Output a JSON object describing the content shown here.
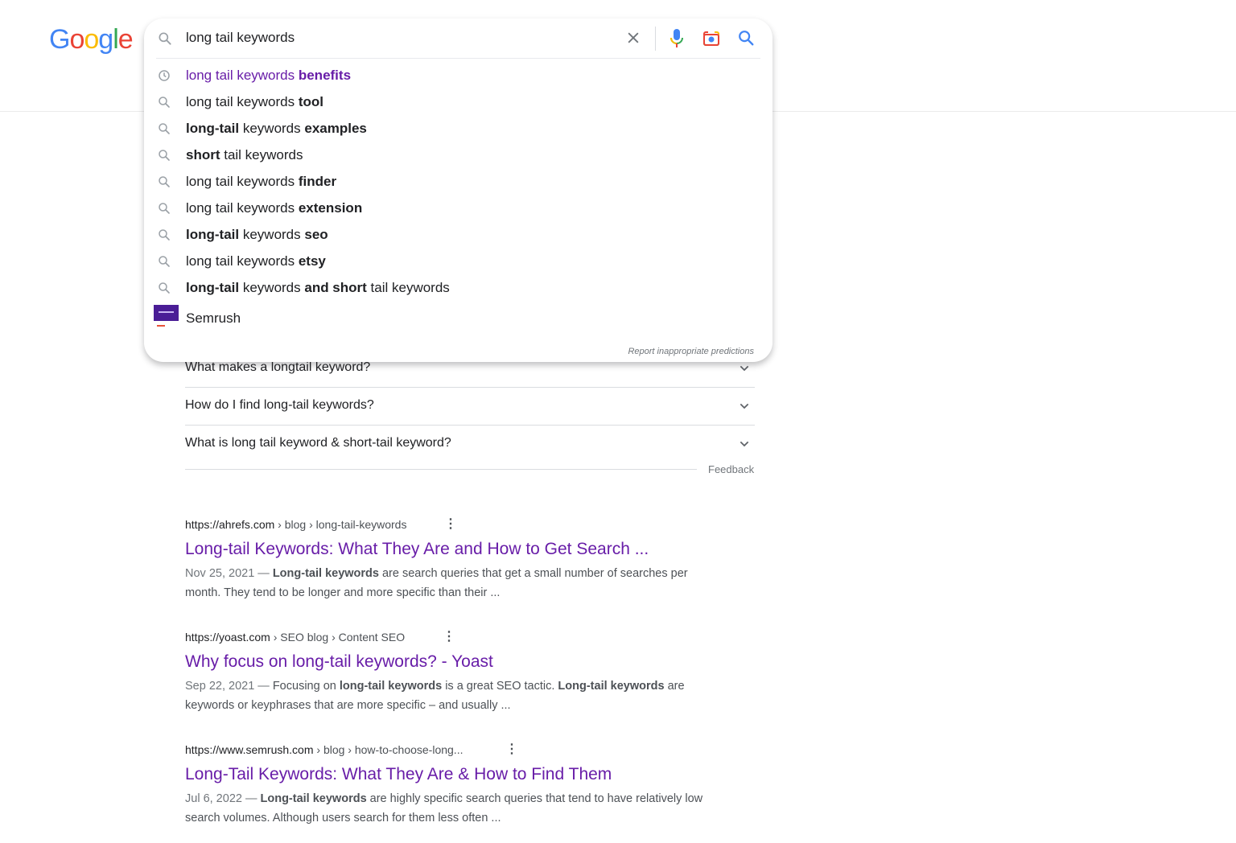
{
  "logo": {
    "letters": [
      "G",
      "o",
      "o",
      "g",
      "l",
      "e"
    ],
    "colors": [
      "#4285f4",
      "#ea4335",
      "#fbbc05",
      "#4285f4",
      "#34a853",
      "#ea4335"
    ]
  },
  "search": {
    "query": "long tail keywords",
    "suggestions": [
      {
        "icon": "history-icon",
        "parts": [
          [
            "long tail keywords ",
            false
          ],
          [
            "benefits",
            true
          ]
        ],
        "visited": true
      },
      {
        "icon": "search-icon",
        "parts": [
          [
            "long tail keywords ",
            false
          ],
          [
            "tool",
            true
          ]
        ]
      },
      {
        "icon": "search-icon",
        "parts": [
          [
            "long-tail",
            true
          ],
          [
            " keywords ",
            false
          ],
          [
            "examples",
            true
          ]
        ]
      },
      {
        "icon": "search-icon",
        "parts": [
          [
            "short",
            true
          ],
          [
            " tail keywords",
            false
          ]
        ]
      },
      {
        "icon": "search-icon",
        "parts": [
          [
            "long tail keywords ",
            false
          ],
          [
            "finder",
            true
          ]
        ]
      },
      {
        "icon": "search-icon",
        "parts": [
          [
            "long tail keywords ",
            false
          ],
          [
            "extension",
            true
          ]
        ]
      },
      {
        "icon": "search-icon",
        "parts": [
          [
            "long-tail",
            true
          ],
          [
            " keywords ",
            false
          ],
          [
            "seo",
            true
          ]
        ]
      },
      {
        "icon": "search-icon",
        "parts": [
          [
            "long tail keywords ",
            false
          ],
          [
            "etsy",
            true
          ]
        ]
      },
      {
        "icon": "search-icon",
        "parts": [
          [
            "long-tail",
            true
          ],
          [
            " keywords ",
            false
          ],
          [
            "and short",
            true
          ],
          [
            " tail keywords",
            false
          ]
        ]
      }
    ],
    "entity_suggestion": "Semrush",
    "report_link": "Report inappropriate predictions"
  },
  "paa": {
    "questions": [
      "What makes a longtail keyword?",
      "How do I find long-tail keywords?",
      "What is long tail keyword & short-tail keyword?"
    ],
    "feedback": "Feedback"
  },
  "results": [
    {
      "domain": "https://ahrefs.com",
      "path": " › blog › long-tail-keywords",
      "title": "Long-tail Keywords: What They Are and How to Get Search ...",
      "date": "Nov 25, 2021 — ",
      "snippet": [
        [
          "Long-tail keywords",
          true
        ],
        [
          " are search queries that get a small number of searches per month. They tend to be longer and more specific than their ...",
          false
        ]
      ]
    },
    {
      "domain": "https://yoast.com",
      "path": " › SEO blog › Content SEO",
      "title": "Why focus on long-tail keywords? - Yoast",
      "date": "Sep 22, 2021 — ",
      "snippet": [
        [
          "Focusing on ",
          false
        ],
        [
          "long-tail keywords",
          true
        ],
        [
          " is a great SEO tactic. ",
          false
        ],
        [
          "Long-tail keywords",
          true
        ],
        [
          " are keywords or keyphrases that are more specific – and usually ...",
          false
        ]
      ]
    },
    {
      "domain": "https://www.semrush.com",
      "path": " › blog › how-to-choose-long...",
      "title": "Long-Tail Keywords: What They Are & How to Find Them",
      "date": "Jul 6, 2022 — ",
      "snippet": [
        [
          "Long-tail keywords",
          true
        ],
        [
          " are highly specific search queries that tend to have relatively low search volumes. Although users search for them less often ...",
          false
        ]
      ]
    }
  ],
  "colors": {
    "visited": "#681da8",
    "text": "#202124",
    "muted": "#4d5156"
  }
}
